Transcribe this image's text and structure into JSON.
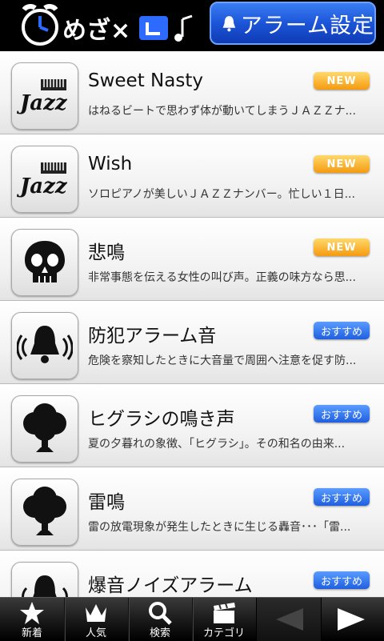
{
  "header": {
    "app_logo_icon": "alarm-clock-logo",
    "alarm_settings_label": "アラーム設定",
    "bell_icon": "bell-icon"
  },
  "list": {
    "items": [
      {
        "icon": "jazz-icon",
        "title": "Sweet Nasty",
        "description": "はねるビートで思わず体が動いてしまうＪＡＺＺナ...",
        "badge": "NEW",
        "badge_type": "new"
      },
      {
        "icon": "jazz-icon",
        "title": "Wish",
        "description": "ソロピアノが美しいＪＡＺＺナンバー。忙しい１日...",
        "badge": "NEW",
        "badge_type": "new"
      },
      {
        "icon": "skull-icon",
        "title": "悲鳴",
        "description": "非常事態を伝える女性の叫び声。正義の味方なら思...",
        "badge": "NEW",
        "badge_type": "new"
      },
      {
        "icon": "alarm-bell-icon",
        "title": "防犯アラーム音",
        "description": "危険を察知したときに大音量で周囲へ注意を促す防...",
        "badge": "おすすめ",
        "badge_type": "rec"
      },
      {
        "icon": "tree-icon",
        "title": "ヒグラシの鳴き声",
        "description": "夏の夕暮れの象徴、「ヒグラシ」。その和名の由来...",
        "badge": "おすすめ",
        "badge_type": "rec"
      },
      {
        "icon": "tree-icon",
        "title": "雷鳴",
        "description": "雷の放電現象が発生したときに生じる轟音･･･「雷...",
        "badge": "おすすめ",
        "badge_type": "rec"
      },
      {
        "icon": "alarm-bell-icon",
        "title": "爆音ノイズアラーム",
        "description": "",
        "badge": "おすすめ",
        "badge_type": "rec"
      }
    ]
  },
  "tabbar": {
    "tabs": [
      {
        "icon": "star-icon",
        "label": "新着"
      },
      {
        "icon": "crown-icon",
        "label": "人気"
      },
      {
        "icon": "magnifier-icon",
        "label": "検索"
      },
      {
        "icon": "clapperboard-icon",
        "label": "カテゴリ"
      }
    ],
    "prev_icon": "arrow-left-icon",
    "next_icon": "arrow-right-icon"
  },
  "colors": {
    "new_badge": "#f59a10",
    "rec_badge": "#1f5fe0",
    "header_button": "#1c55d8"
  }
}
